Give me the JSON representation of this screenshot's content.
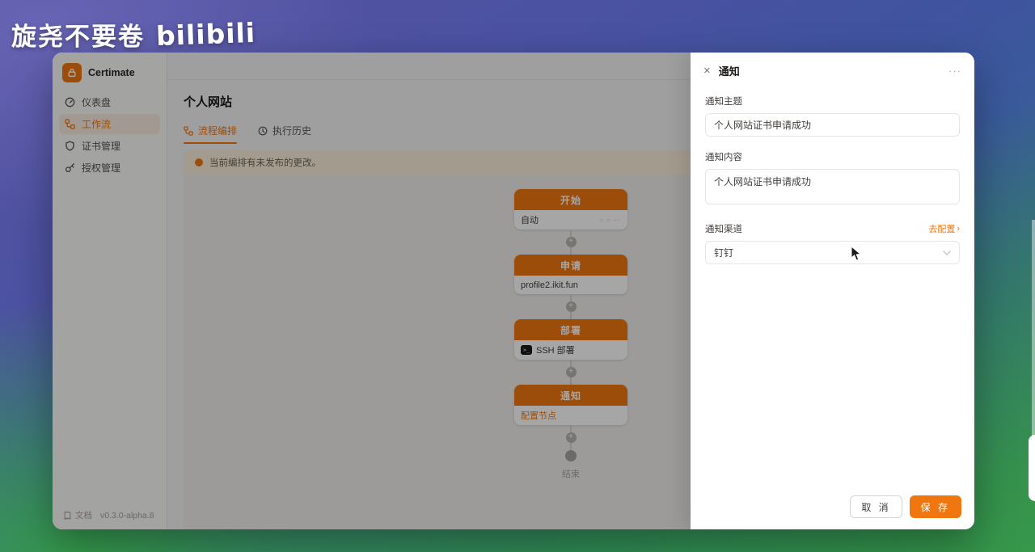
{
  "colors": {
    "accent": "#f0770f",
    "mask": "rgba(0,0,0,0.35)",
    "node_header": "#f0770f",
    "wallpaper_green": "#35914d",
    "wallpaper_blue": "#40539f",
    "wallpaper_purple": "#55519d"
  },
  "icons": {
    "close": "×",
    "more": "···",
    "plus": "+",
    "config_arrow": "›",
    "start_actions": "○ ○ ⋯",
    "terminal_glyph": ">_",
    "banner_mark": "!"
  },
  "overlay": {
    "streamer_text": "旋尧不要卷",
    "logo_text": "bilibili"
  },
  "app": {
    "brand": {
      "name": "Certimate"
    },
    "sidebar": {
      "items": [
        {
          "label": "仪表盘",
          "icon": "dashboard-icon",
          "active": false
        },
        {
          "label": "工作流",
          "icon": "workflow-icon",
          "active": true
        },
        {
          "label": "证书管理",
          "icon": "certificate-icon",
          "active": false
        },
        {
          "label": "授权管理",
          "icon": "key-icon",
          "active": false
        }
      ],
      "footer": {
        "docs_label": "文档",
        "version": "v0.3.0-alpha.8"
      }
    },
    "main": {
      "title": "个人网站",
      "tabs": [
        {
          "label": "流程编排",
          "icon": "flow-icon",
          "active": true
        },
        {
          "label": "执行历史",
          "icon": "history-icon",
          "active": false
        }
      ],
      "banner": {
        "text": "当前编排有未发布的更改。"
      },
      "workflow": {
        "nodes": [
          {
            "type": "start",
            "title": "开始",
            "subtitle": "自动"
          },
          {
            "type": "apply",
            "title": "申请",
            "subtitle": "profile2.ikit.fun"
          },
          {
            "type": "deploy",
            "title": "部署",
            "subtitle": "SSH 部署"
          },
          {
            "type": "notify",
            "title": "通知",
            "subtitle": "配置节点"
          }
        ],
        "end_label": "结束"
      }
    },
    "drawer": {
      "title": "通知",
      "subject": {
        "label": "通知主题",
        "value": "个人网站证书申请成功"
      },
      "content": {
        "label": "通知内容",
        "value": "个人网站证书申请成功"
      },
      "channel": {
        "label": "通知渠道",
        "action_label": "去配置",
        "value": "钉钉"
      },
      "footer": {
        "cancel_label": "取 消",
        "save_label": "保 存"
      }
    }
  }
}
